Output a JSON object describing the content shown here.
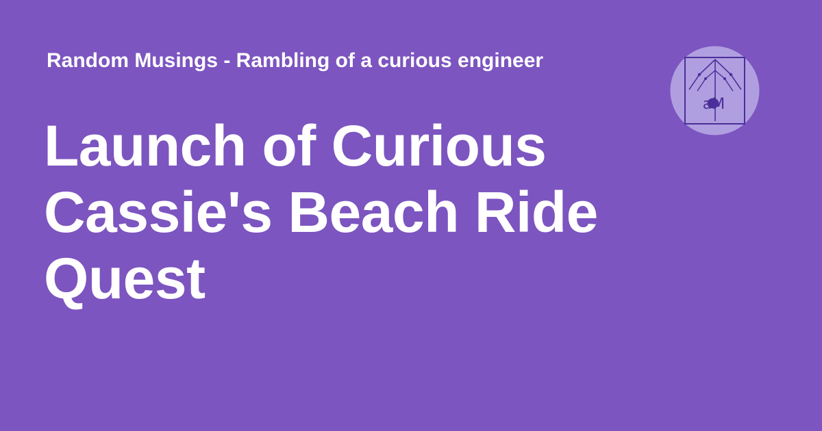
{
  "card": {
    "background_color": "#7c55c0",
    "site_name": "Random Musings - Rambling of a curious engineer",
    "post_title": "Launch of Curious Cassie's Beach Ride Quest"
  },
  "logo": {
    "icon": "site-logo-icon",
    "monogram": "aM",
    "circle_color": "#b09fe0",
    "stroke_color": "#4a2f9a"
  }
}
